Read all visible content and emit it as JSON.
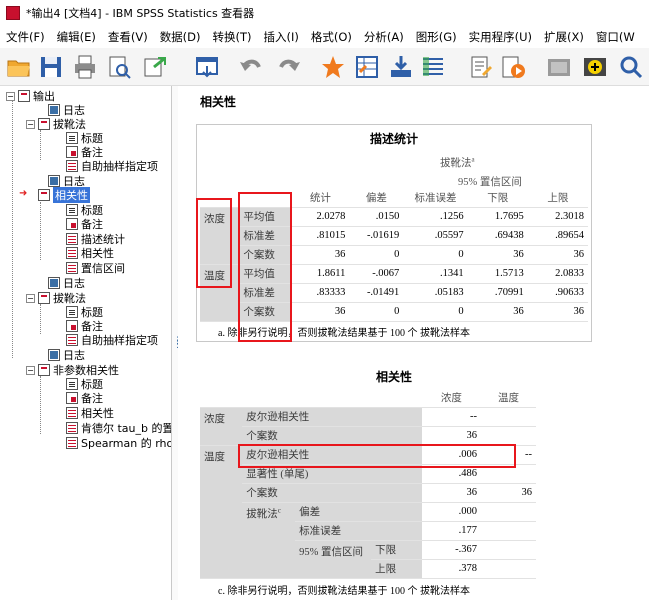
{
  "window": {
    "title": "*输出4 [文档4] - IBM SPSS Statistics 查看器"
  },
  "menu": [
    "文件(F)",
    "编辑(E)",
    "查看(V)",
    "数据(D)",
    "转换(T)",
    "插入(I)",
    "格式(O)",
    "分析(A)",
    "图形(G)",
    "实用程序(U)",
    "扩展(X)",
    "窗口(W"
  ],
  "toolbar": [
    "open-icon",
    "save-icon",
    "print-icon",
    "preview-icon",
    "export-icon",
    "recall-dialog-icon",
    "undo-icon",
    "redo-icon",
    "goto-data-icon",
    "goto-case-icon",
    "goto-variable-icon",
    "variables-icon",
    "designate-window-icon",
    "run-script-icon",
    "show-hide-icon",
    "insert-output-icon",
    "find-icon"
  ],
  "nav": {
    "items": [
      {
        "label": "输出",
        "icon": "book"
      },
      {
        "label": "日志",
        "icon": "log"
      },
      {
        "label": "拔靴法",
        "icon": "book"
      },
      {
        "label": "标题",
        "icon": "doc"
      },
      {
        "label": "备注",
        "icon": "note"
      },
      {
        "label": "自助抽样指定项",
        "icon": "table"
      },
      {
        "label": "日志",
        "icon": "log"
      },
      {
        "label": "相关性",
        "icon": "book"
      },
      {
        "label": "标题",
        "icon": "doc"
      },
      {
        "label": "备注",
        "icon": "note"
      },
      {
        "label": "描述统计",
        "icon": "table"
      },
      {
        "label": "相关性",
        "icon": "table"
      },
      {
        "label": "置信区间",
        "icon": "table"
      },
      {
        "label": "日志",
        "icon": "log"
      },
      {
        "label": "拔靴法",
        "icon": "book"
      },
      {
        "label": "标题",
        "icon": "doc"
      },
      {
        "label": "备注",
        "icon": "note"
      },
      {
        "label": "自助抽样指定项",
        "icon": "table"
      },
      {
        "label": "日志",
        "icon": "log"
      },
      {
        "label": "非参数相关性",
        "icon": "book"
      },
      {
        "label": "标题",
        "icon": "doc"
      },
      {
        "label": "备注",
        "icon": "note"
      },
      {
        "label": "相关性",
        "icon": "table"
      },
      {
        "label": "肯德尔 tau_b 的置",
        "icon": "table"
      },
      {
        "label": "Spearman 的 rho",
        "icon": "table"
      }
    ]
  },
  "content": {
    "heading": "相关性",
    "desc": {
      "title": "描述统计",
      "bootstrap_label": "拔靴法",
      "bootstrap_sup": "a",
      "ci_label": "95% 置信区间",
      "col_headers": [
        "统计",
        "偏差",
        "标准误差",
        "下限",
        "上限"
      ],
      "groups": [
        {
          "name": "浓度",
          "rows": [
            {
              "label": "平均值",
              "values": [
                "2.0278",
                ".0150",
                ".1256",
                "1.7695",
                "2.3018"
              ]
            },
            {
              "label": "标准差",
              "values": [
                ".81015",
                "-.01619",
                ".05597",
                ".69438",
                ".89654"
              ]
            },
            {
              "label": "个案数",
              "values": [
                "36",
                "0",
                "0",
                "36",
                "36"
              ]
            }
          ]
        },
        {
          "name": "温度",
          "rows": [
            {
              "label": "平均值",
              "values": [
                "1.8611",
                "-.0067",
                ".1341",
                "1.5713",
                "2.0833"
              ]
            },
            {
              "label": "标准差",
              "values": [
                ".83333",
                "-.01491",
                ".05183",
                ".70991",
                ".90633"
              ]
            },
            {
              "label": "个案数",
              "values": [
                "36",
                "0",
                "0",
                "36",
                "36"
              ]
            }
          ]
        }
      ],
      "footnote": "a. 除非另行说明，否则拔靴法结果基于 100 个 拔靴法样本"
    },
    "corr": {
      "title": "相关性",
      "col_headers": [
        "浓度",
        "温度"
      ],
      "var1": "浓度",
      "var2": "温度",
      "r1_label": "皮尔逊相关性",
      "r1_values": [
        "--",
        ""
      ],
      "n1_label": "个案数",
      "n1_values": [
        "36",
        ""
      ],
      "r2_label": "皮尔逊相关性",
      "r2_values": [
        ".006",
        "--"
      ],
      "sig_label": "显著性 (单尾)",
      "sig_values": [
        ".486",
        ""
      ],
      "n2_label": "个案数",
      "n2_values": [
        "36",
        "36"
      ],
      "boot_label": "拔靴法",
      "boot_sup": "c",
      "bias_label": "偏差",
      "bias_value": ".000",
      "se_label": "标准误差",
      "se_value": ".177",
      "ci_label": "95% 置信区间",
      "lower_label": "下限",
      "lower_value": "-.367",
      "upper_label": "上限",
      "upper_value": ".378",
      "footnote": "c. 除非另行说明，否则拔靴法结果基于 100 个 拔靴法样本"
    }
  },
  "colors": {
    "highlight_box": "#e8161c",
    "selection": "#3874d8",
    "row_label_bg": "#d9d9d9"
  }
}
